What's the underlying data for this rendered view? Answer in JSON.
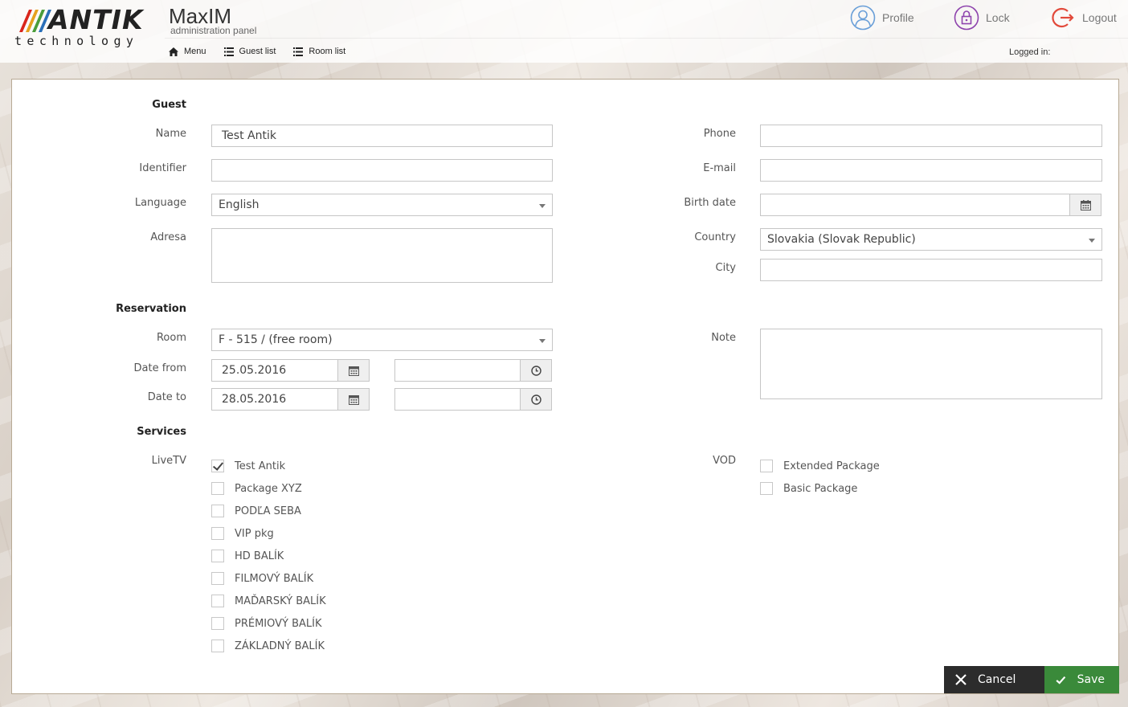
{
  "brand": {
    "logo_main": "ANTIK",
    "logo_sub": "technology",
    "app_title": "MaxIM",
    "app_subtitle": "administration panel"
  },
  "nav": [
    {
      "label": "Menu",
      "icon": "home-icon"
    },
    {
      "label": "Guest list",
      "icon": "list-icon"
    },
    {
      "label": "Room list",
      "icon": "list-icon"
    }
  ],
  "top_actions": {
    "profile": "Profile",
    "lock": "Lock",
    "logout": "Logout"
  },
  "logged_in_label": "Logged in:",
  "colors": {
    "profile": "#6a9fd8",
    "lock": "#8e44ad",
    "logout": "#e24a3b",
    "save": "#3a8a3a",
    "cancel": "#2c2c2c"
  },
  "form": {
    "guest_section": "Guest",
    "name_label": "Name",
    "name_value": "Test Antik",
    "identifier_label": "Identifier",
    "identifier_value": "",
    "language_label": "Language",
    "language_value": "English",
    "address_label": "Adresa",
    "address_value": "",
    "phone_label": "Phone",
    "phone_value": "",
    "email_label": "E-mail",
    "email_value": "",
    "birthdate_label": "Birth date",
    "birthdate_value": "",
    "country_label": "Country",
    "country_value": "Slovakia (Slovak Republic)",
    "city_label": "City",
    "city_value": "",
    "reservation_section": "Reservation",
    "room_label": "Room",
    "room_value": "F - 515 / (free room)",
    "date_from_label": "Date from",
    "date_from_value": "25.05.2016",
    "time_from_value": "",
    "date_to_label": "Date to",
    "date_to_value": "28.05.2016",
    "time_to_value": "",
    "note_label": "Note",
    "note_value": "",
    "services_section": "Services",
    "livetv_label": "LiveTV",
    "vod_label": "VOD"
  },
  "livetv_packages": [
    {
      "label": "Test Antik",
      "checked": true
    },
    {
      "label": "Package XYZ",
      "checked": false
    },
    {
      "label": "PODĽA SEBA",
      "checked": false
    },
    {
      "label": "VIP pkg",
      "checked": false
    },
    {
      "label": "HD BALÍK",
      "checked": false
    },
    {
      "label": "FILMOVÝ BALÍK",
      "checked": false
    },
    {
      "label": "MAĎARSKÝ BALÍK",
      "checked": false
    },
    {
      "label": "PRÉMIOVÝ BALÍK",
      "checked": false
    },
    {
      "label": "ZÁKLADNÝ BALÍK",
      "checked": false
    }
  ],
  "vod_packages": [
    {
      "label": "Extended Package",
      "checked": false
    },
    {
      "label": "Basic Package",
      "checked": false
    }
  ],
  "buttons": {
    "cancel": "Cancel",
    "save": "Save"
  }
}
